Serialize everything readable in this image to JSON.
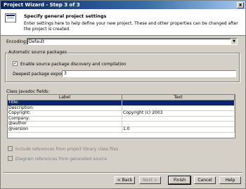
{
  "window": {
    "title": "Project Wizard - Step 3 of 3",
    "close_glyph": "x"
  },
  "header": {
    "title": "Specify general project settings",
    "description": "Enter settings here to help define your new project. These and other properties can be changed after the project is created."
  },
  "encoding": {
    "label": "Encoding:",
    "value": "Default"
  },
  "source_packages": {
    "legend": "Automatic source packages",
    "enable_label": "Enable source package discovery and compilation",
    "enable_checked": true,
    "deepest_label": "Deepest package exposed:",
    "deepest_value": "3"
  },
  "javadoc": {
    "label": "Class Javadoc fields:",
    "columns": [
      "Label",
      "Text"
    ],
    "rows": [
      {
        "label": "Title:",
        "text": ""
      },
      {
        "label": "Description:",
        "text": ""
      },
      {
        "label": "Copyright:",
        "text": "Copyright (c) 2003"
      },
      {
        "label": "Company:",
        "text": ""
      },
      {
        "label": "@author",
        "text": ""
      },
      {
        "label": "@version",
        "text": "1.0"
      }
    ],
    "selected_row": 0
  },
  "options": {
    "include_library_refs": "Include references from project library class files",
    "diagram_refs": "Diagram references from generated source"
  },
  "buttons": {
    "back": "< Back",
    "next": "Next >",
    "finish": "Finish",
    "cancel": "Cancel",
    "help": "Help"
  },
  "colors": {
    "title_bar": "#0a246a",
    "dialog_bg": "#d4d0c8",
    "selection": "#0a246a"
  }
}
